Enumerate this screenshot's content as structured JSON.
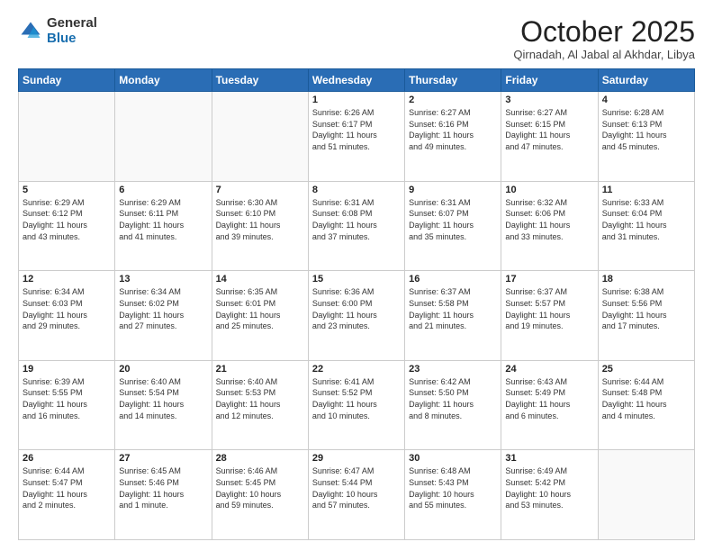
{
  "logo": {
    "general": "General",
    "blue": "Blue"
  },
  "header": {
    "month": "October 2025",
    "location": "Qirnadah, Al Jabal al Akhdar, Libya"
  },
  "days_of_week": [
    "Sunday",
    "Monday",
    "Tuesday",
    "Wednesday",
    "Thursday",
    "Friday",
    "Saturday"
  ],
  "weeks": [
    [
      {
        "day": "",
        "info": ""
      },
      {
        "day": "",
        "info": ""
      },
      {
        "day": "",
        "info": ""
      },
      {
        "day": "1",
        "info": "Sunrise: 6:26 AM\nSunset: 6:17 PM\nDaylight: 11 hours\nand 51 minutes."
      },
      {
        "day": "2",
        "info": "Sunrise: 6:27 AM\nSunset: 6:16 PM\nDaylight: 11 hours\nand 49 minutes."
      },
      {
        "day": "3",
        "info": "Sunrise: 6:27 AM\nSunset: 6:15 PM\nDaylight: 11 hours\nand 47 minutes."
      },
      {
        "day": "4",
        "info": "Sunrise: 6:28 AM\nSunset: 6:13 PM\nDaylight: 11 hours\nand 45 minutes."
      }
    ],
    [
      {
        "day": "5",
        "info": "Sunrise: 6:29 AM\nSunset: 6:12 PM\nDaylight: 11 hours\nand 43 minutes."
      },
      {
        "day": "6",
        "info": "Sunrise: 6:29 AM\nSunset: 6:11 PM\nDaylight: 11 hours\nand 41 minutes."
      },
      {
        "day": "7",
        "info": "Sunrise: 6:30 AM\nSunset: 6:10 PM\nDaylight: 11 hours\nand 39 minutes."
      },
      {
        "day": "8",
        "info": "Sunrise: 6:31 AM\nSunset: 6:08 PM\nDaylight: 11 hours\nand 37 minutes."
      },
      {
        "day": "9",
        "info": "Sunrise: 6:31 AM\nSunset: 6:07 PM\nDaylight: 11 hours\nand 35 minutes."
      },
      {
        "day": "10",
        "info": "Sunrise: 6:32 AM\nSunset: 6:06 PM\nDaylight: 11 hours\nand 33 minutes."
      },
      {
        "day": "11",
        "info": "Sunrise: 6:33 AM\nSunset: 6:04 PM\nDaylight: 11 hours\nand 31 minutes."
      }
    ],
    [
      {
        "day": "12",
        "info": "Sunrise: 6:34 AM\nSunset: 6:03 PM\nDaylight: 11 hours\nand 29 minutes."
      },
      {
        "day": "13",
        "info": "Sunrise: 6:34 AM\nSunset: 6:02 PM\nDaylight: 11 hours\nand 27 minutes."
      },
      {
        "day": "14",
        "info": "Sunrise: 6:35 AM\nSunset: 6:01 PM\nDaylight: 11 hours\nand 25 minutes."
      },
      {
        "day": "15",
        "info": "Sunrise: 6:36 AM\nSunset: 6:00 PM\nDaylight: 11 hours\nand 23 minutes."
      },
      {
        "day": "16",
        "info": "Sunrise: 6:37 AM\nSunset: 5:58 PM\nDaylight: 11 hours\nand 21 minutes."
      },
      {
        "day": "17",
        "info": "Sunrise: 6:37 AM\nSunset: 5:57 PM\nDaylight: 11 hours\nand 19 minutes."
      },
      {
        "day": "18",
        "info": "Sunrise: 6:38 AM\nSunset: 5:56 PM\nDaylight: 11 hours\nand 17 minutes."
      }
    ],
    [
      {
        "day": "19",
        "info": "Sunrise: 6:39 AM\nSunset: 5:55 PM\nDaylight: 11 hours\nand 16 minutes."
      },
      {
        "day": "20",
        "info": "Sunrise: 6:40 AM\nSunset: 5:54 PM\nDaylight: 11 hours\nand 14 minutes."
      },
      {
        "day": "21",
        "info": "Sunrise: 6:40 AM\nSunset: 5:53 PM\nDaylight: 11 hours\nand 12 minutes."
      },
      {
        "day": "22",
        "info": "Sunrise: 6:41 AM\nSunset: 5:52 PM\nDaylight: 11 hours\nand 10 minutes."
      },
      {
        "day": "23",
        "info": "Sunrise: 6:42 AM\nSunset: 5:50 PM\nDaylight: 11 hours\nand 8 minutes."
      },
      {
        "day": "24",
        "info": "Sunrise: 6:43 AM\nSunset: 5:49 PM\nDaylight: 11 hours\nand 6 minutes."
      },
      {
        "day": "25",
        "info": "Sunrise: 6:44 AM\nSunset: 5:48 PM\nDaylight: 11 hours\nand 4 minutes."
      }
    ],
    [
      {
        "day": "26",
        "info": "Sunrise: 6:44 AM\nSunset: 5:47 PM\nDaylight: 11 hours\nand 2 minutes."
      },
      {
        "day": "27",
        "info": "Sunrise: 6:45 AM\nSunset: 5:46 PM\nDaylight: 11 hours\nand 1 minute."
      },
      {
        "day": "28",
        "info": "Sunrise: 6:46 AM\nSunset: 5:45 PM\nDaylight: 10 hours\nand 59 minutes."
      },
      {
        "day": "29",
        "info": "Sunrise: 6:47 AM\nSunset: 5:44 PM\nDaylight: 10 hours\nand 57 minutes."
      },
      {
        "day": "30",
        "info": "Sunrise: 6:48 AM\nSunset: 5:43 PM\nDaylight: 10 hours\nand 55 minutes."
      },
      {
        "day": "31",
        "info": "Sunrise: 6:49 AM\nSunset: 5:42 PM\nDaylight: 10 hours\nand 53 minutes."
      },
      {
        "day": "",
        "info": ""
      }
    ]
  ]
}
